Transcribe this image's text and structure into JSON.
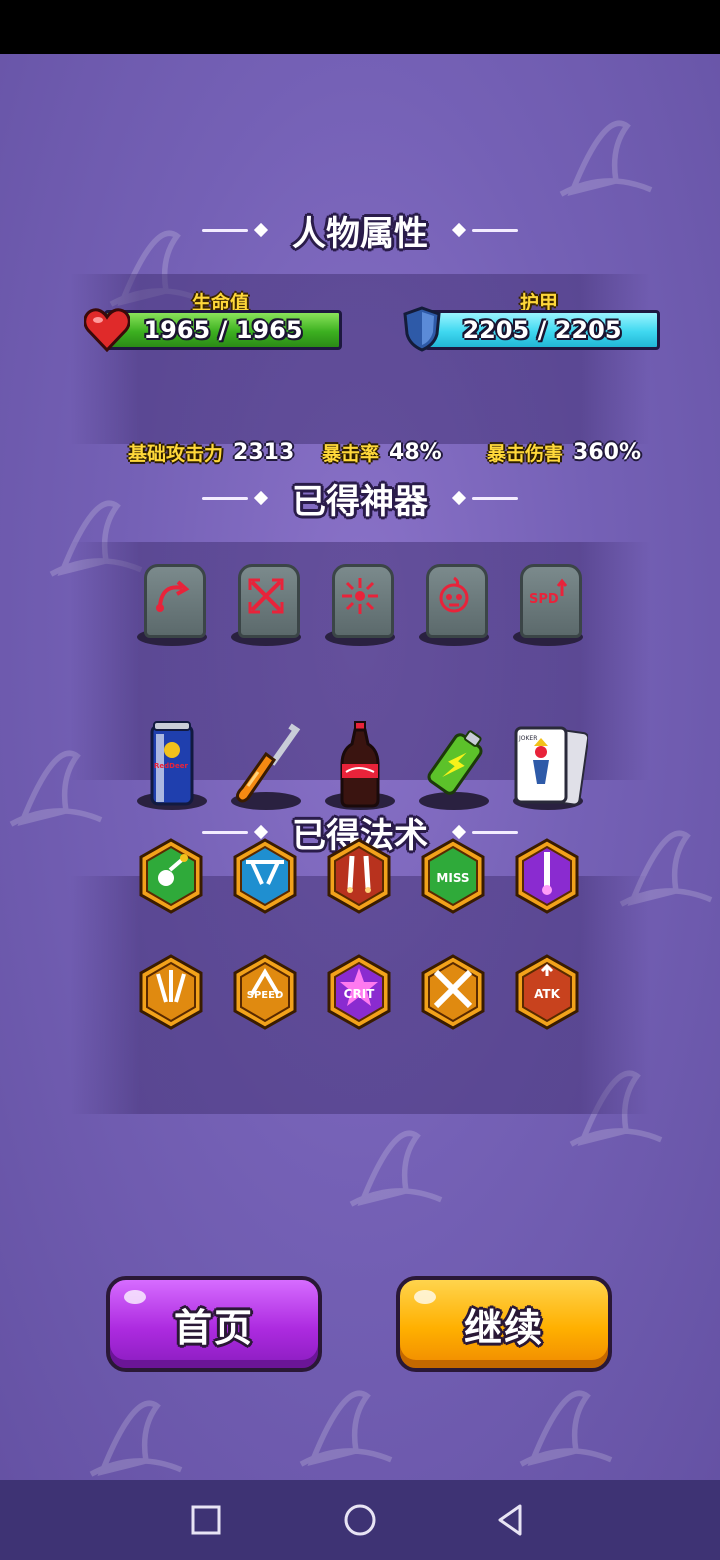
{
  "sections": {
    "attributes_title": "人物属性",
    "artifacts_title": "已得神器",
    "spells_title": "已得法术"
  },
  "hp": {
    "label": "生命值",
    "value": "1965 / 1965",
    "fill": 1.0,
    "color": "#3cb020"
  },
  "armor": {
    "label": "护甲",
    "value": "2205 / 2205",
    "fill": 1.0,
    "color": "#3fd8f0"
  },
  "stats": [
    {
      "label": "基础攻击力",
      "value": "2313"
    },
    {
      "label": "暴击率",
      "value": "48%"
    },
    {
      "label": "暴击伤害",
      "value": "360%"
    }
  ],
  "artifact_runes": [
    {
      "icon": "curved-arrow-rune-icon"
    },
    {
      "icon": "cross-arrows-rune-icon"
    },
    {
      "icon": "star-burst-rune-icon"
    },
    {
      "icon": "skull-fire-rune-icon"
    },
    {
      "icon": "spd-rune-icon",
      "text": "SPD"
    }
  ],
  "artifact_items": [
    {
      "icon": "energy-drink-can-icon",
      "text": "RedDeer"
    },
    {
      "icon": "screwdriver-icon"
    },
    {
      "icon": "cola-bottle-icon"
    },
    {
      "icon": "battery-icon"
    },
    {
      "icon": "joker-card-icon",
      "text": "JOKER"
    }
  ],
  "spells": [
    {
      "icon": "skull-pin-spell-icon",
      "color": "#2faa3a"
    },
    {
      "icon": "ricochet-spell-icon",
      "color": "#1f8fd0"
    },
    {
      "icon": "double-claw-spell-icon",
      "color": "#b8321e"
    },
    {
      "icon": "miss-spell-icon",
      "color": "#2faa3a",
      "text": "MISS"
    },
    {
      "icon": "purple-bolt-spell-icon",
      "color": "#8a2bd0"
    },
    {
      "icon": "triple-shot-spell-icon",
      "color": "#e08a10"
    },
    {
      "icon": "speed-up-spell-icon",
      "color": "#e08a10",
      "text": "SPEED"
    },
    {
      "icon": "crit-spell-icon",
      "color": "#8a2bd0",
      "text": "CRIT"
    },
    {
      "icon": "crossed-swords-spell-icon",
      "color": "#e08a10"
    },
    {
      "icon": "atk-up-spell-icon",
      "color": "#c8421e",
      "text": "ATK"
    }
  ],
  "buttons": {
    "home": "首页",
    "continue": "继续"
  }
}
